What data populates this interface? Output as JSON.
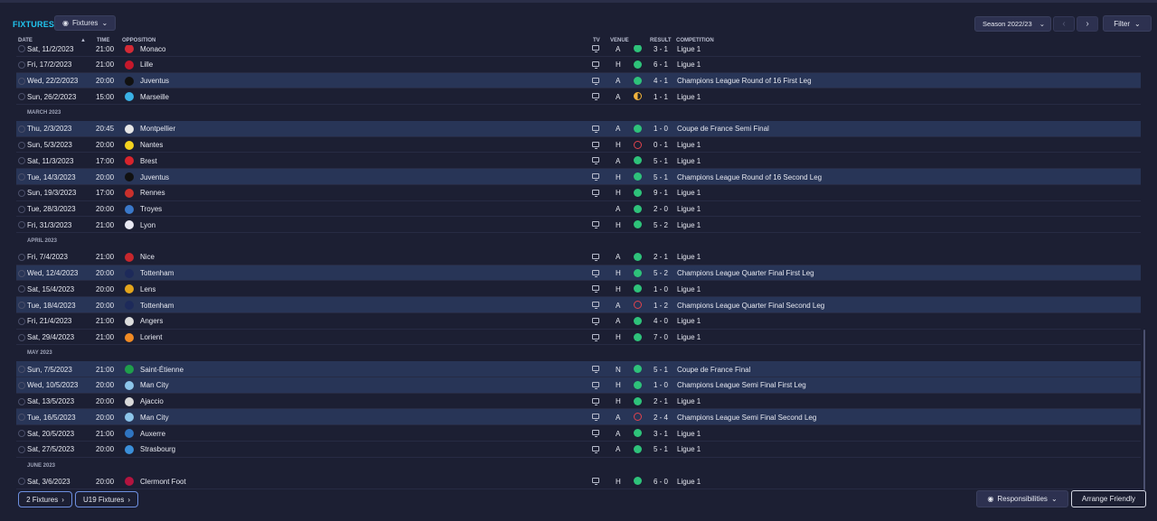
{
  "header": {
    "title": "FIXTURES",
    "view_dropdown": "Fixtures",
    "season": "Season 2022/23",
    "filter": "Filter"
  },
  "columns": {
    "date": "DATE",
    "time": "TIME",
    "opposition": "OPPOSITION",
    "tv": "TV",
    "venue": "VENUE",
    "result": "RESULT",
    "competition": "COMPETITION"
  },
  "colors": {
    "win": "#2ec27a",
    "loss": "#e0434d",
    "draw": "#f2b33d",
    "accent": "#21c6f0"
  },
  "rows": [
    {
      "type": "fixture",
      "date": "Sat, 11/2/2023",
      "time": "21:00",
      "opp": "Monaco",
      "badge": "#d52b36",
      "tv": true,
      "venue": "A",
      "res": "w",
      "score": "3 - 1",
      "comp": "Ligue 1",
      "hl": false
    },
    {
      "type": "fixture",
      "date": "Fri, 17/2/2023",
      "time": "21:00",
      "opp": "Lille",
      "badge": "#c5182b",
      "tv": true,
      "venue": "H",
      "res": "w",
      "score": "6 - 1",
      "comp": "Ligue 1",
      "hl": false
    },
    {
      "type": "fixture",
      "date": "Wed, 22/2/2023",
      "time": "20:00",
      "opp": "Juventus",
      "badge": "#111111",
      "tv": true,
      "venue": "A",
      "res": "w",
      "score": "4 - 1",
      "comp": "Champions League Round of 16 First Leg",
      "hl": true
    },
    {
      "type": "fixture",
      "date": "Sun, 26/2/2023",
      "time": "15:00",
      "opp": "Marseille",
      "badge": "#3ab1e5",
      "tv": true,
      "venue": "A",
      "res": "d",
      "score": "1 - 1",
      "comp": "Ligue 1",
      "hl": false
    },
    {
      "type": "month",
      "label": "MARCH 2023"
    },
    {
      "type": "fixture",
      "date": "Thu, 2/3/2023",
      "time": "20:45",
      "opp": "Montpellier",
      "badge": "#e6e6e6",
      "tv": true,
      "venue": "A",
      "res": "w",
      "score": "1 - 0",
      "comp": "Coupe de France Semi Final",
      "hl": true
    },
    {
      "type": "fixture",
      "date": "Sun, 5/3/2023",
      "time": "20:00",
      "opp": "Nantes",
      "badge": "#f4d21f",
      "tv": true,
      "venue": "H",
      "res": "l",
      "score": "0 - 1",
      "comp": "Ligue 1",
      "hl": false
    },
    {
      "type": "fixture",
      "date": "Sat, 11/3/2023",
      "time": "17:00",
      "opp": "Brest",
      "badge": "#d8242c",
      "tv": true,
      "venue": "A",
      "res": "w",
      "score": "5 - 1",
      "comp": "Ligue 1",
      "hl": false
    },
    {
      "type": "fixture",
      "date": "Tue, 14/3/2023",
      "time": "20:00",
      "opp": "Juventus",
      "badge": "#111111",
      "tv": true,
      "venue": "H",
      "res": "w",
      "score": "5 - 1",
      "comp": "Champions League Round of 16 Second Leg",
      "hl": true
    },
    {
      "type": "fixture",
      "date": "Sun, 19/3/2023",
      "time": "17:00",
      "opp": "Rennes",
      "badge": "#c9302c",
      "tv": true,
      "venue": "H",
      "res": "w",
      "score": "9 - 1",
      "comp": "Ligue 1",
      "hl": false
    },
    {
      "type": "fixture",
      "date": "Tue, 28/3/2023",
      "time": "20:00",
      "opp": "Troyes",
      "badge": "#3a78c9",
      "tv": false,
      "venue": "A",
      "res": "w",
      "score": "2 - 0",
      "comp": "Ligue 1",
      "hl": false
    },
    {
      "type": "fixture",
      "date": "Fri, 31/3/2023",
      "time": "21:00",
      "opp": "Lyon",
      "badge": "#e8e8f2",
      "tv": true,
      "venue": "H",
      "res": "w",
      "score": "5 - 2",
      "comp": "Ligue 1",
      "hl": false
    },
    {
      "type": "month",
      "label": "APRIL 2023"
    },
    {
      "type": "fixture",
      "date": "Fri, 7/4/2023",
      "time": "21:00",
      "opp": "Nice",
      "badge": "#c7272d",
      "tv": true,
      "venue": "A",
      "res": "w",
      "score": "2 - 1",
      "comp": "Ligue 1",
      "hl": false
    },
    {
      "type": "fixture",
      "date": "Wed, 12/4/2023",
      "time": "20:00",
      "opp": "Tottenham",
      "badge": "#1d2a5a",
      "tv": true,
      "venue": "H",
      "res": "w",
      "score": "5 - 2",
      "comp": "Champions League Quarter Final First Leg",
      "hl": true
    },
    {
      "type": "fixture",
      "date": "Sat, 15/4/2023",
      "time": "20:00",
      "opp": "Lens",
      "badge": "#e3a51c",
      "tv": true,
      "venue": "H",
      "res": "w",
      "score": "1 - 0",
      "comp": "Ligue 1",
      "hl": false
    },
    {
      "type": "fixture",
      "date": "Tue, 18/4/2023",
      "time": "20:00",
      "opp": "Tottenham",
      "badge": "#1d2a5a",
      "tv": true,
      "venue": "A",
      "res": "l",
      "score": "1 - 2",
      "comp": "Champions League Quarter Final Second Leg",
      "hl": true
    },
    {
      "type": "fixture",
      "date": "Fri, 21/4/2023",
      "time": "21:00",
      "opp": "Angers",
      "badge": "#dddddd",
      "tv": true,
      "venue": "A",
      "res": "w",
      "score": "4 - 0",
      "comp": "Ligue 1",
      "hl": false
    },
    {
      "type": "fixture",
      "date": "Sat, 29/4/2023",
      "time": "21:00",
      "opp": "Lorient",
      "badge": "#f08a24",
      "tv": true,
      "venue": "H",
      "res": "w",
      "score": "7 - 0",
      "comp": "Ligue 1",
      "hl": false
    },
    {
      "type": "month",
      "label": "MAY 2023"
    },
    {
      "type": "fixture",
      "date": "Sun, 7/5/2023",
      "time": "21:00",
      "opp": "Saint-Étienne",
      "badge": "#1f9e4b",
      "tv": true,
      "venue": "N",
      "res": "w",
      "score": "5 - 1",
      "comp": "Coupe de France Final",
      "hl": true
    },
    {
      "type": "fixture",
      "date": "Wed, 10/5/2023",
      "time": "20:00",
      "opp": "Man City",
      "badge": "#8cc5ea",
      "tv": true,
      "venue": "H",
      "res": "w",
      "score": "1 - 0",
      "comp": "Champions League Semi Final First Leg",
      "hl": true
    },
    {
      "type": "fixture",
      "date": "Sat, 13/5/2023",
      "time": "20:00",
      "opp": "Ajaccio",
      "badge": "#d9d9d9",
      "tv": true,
      "venue": "H",
      "res": "w",
      "score": "2 - 1",
      "comp": "Ligue 1",
      "hl": false
    },
    {
      "type": "fixture",
      "date": "Tue, 16/5/2023",
      "time": "20:00",
      "opp": "Man City",
      "badge": "#8cc5ea",
      "tv": true,
      "venue": "A",
      "res": "l",
      "score": "2 - 4",
      "comp": "Champions League Semi Final Second Leg",
      "hl": true
    },
    {
      "type": "fixture",
      "date": "Sat, 20/5/2023",
      "time": "21:00",
      "opp": "Auxerre",
      "badge": "#2f74c0",
      "tv": true,
      "venue": "A",
      "res": "w",
      "score": "3 - 1",
      "comp": "Ligue 1",
      "hl": false
    },
    {
      "type": "fixture",
      "date": "Sat, 27/5/2023",
      "time": "20:00",
      "opp": "Strasbourg",
      "badge": "#3b8fd9",
      "tv": true,
      "venue": "A",
      "res": "w",
      "score": "5 - 1",
      "comp": "Ligue 1",
      "hl": false
    },
    {
      "type": "month",
      "label": "JUNE 2023"
    },
    {
      "type": "fixture",
      "date": "Sat, 3/6/2023",
      "time": "20:00",
      "opp": "Clermont Foot",
      "badge": "#b3143f",
      "tv": true,
      "venue": "H",
      "res": "w",
      "score": "6 - 0",
      "comp": "Ligue 1",
      "hl": false
    }
  ],
  "footer": {
    "fixtures_btn": "2 Fixtures",
    "u19_btn": "U19 Fixtures",
    "responsibilities": "Responsibilities",
    "arrange_friendly": "Arrange Friendly"
  }
}
